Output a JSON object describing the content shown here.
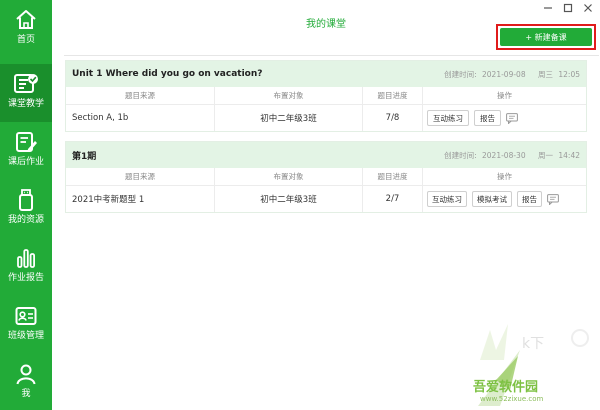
{
  "sidebar": {
    "items": [
      {
        "label": "首页",
        "icon": "home-icon"
      },
      {
        "label": "课堂教学",
        "icon": "classroom-icon",
        "active": true
      },
      {
        "label": "课后作业",
        "icon": "homework-icon"
      },
      {
        "label": "我的资源",
        "icon": "resource-icon"
      },
      {
        "label": "作业报告",
        "icon": "report-chart-icon"
      },
      {
        "label": "班级管理",
        "icon": "class-manage-icon"
      },
      {
        "label": "我",
        "icon": "user-icon"
      }
    ]
  },
  "header": {
    "title": "我的课堂",
    "new_button": "+ 新建备课"
  },
  "table_headers": [
    "题目来源",
    "布置对象",
    "题目进度",
    "操作"
  ],
  "lessons": [
    {
      "title": "Unit 1 Where did you go on vacation?",
      "created_label": "创建时间:",
      "created_date": "2021-09-08",
      "weekday": "周三",
      "time": "12:05",
      "rows": [
        {
          "source": "Section A, 1b",
          "target": "初中二年级3班",
          "progress": "7/8",
          "actions": [
            "互动练习",
            "报告"
          ]
        }
      ]
    },
    {
      "title": "第1期",
      "created_label": "创建时间:",
      "created_date": "2021-08-30",
      "weekday": "周一",
      "time": "14:42",
      "rows": [
        {
          "source": "2021中考新题型 1",
          "target": "初中二年级3班",
          "progress": "2/7",
          "actions": [
            "互动练习",
            "模拟考试",
            "报告"
          ]
        }
      ]
    }
  ],
  "watermark": {
    "site_name": "吾爱软件园",
    "url": "www.52zixue.com"
  },
  "colors": {
    "brand_green": "#22ab38",
    "active_nav": "#1a8f2c",
    "header_bg": "#e3f4e5",
    "highlight_red": "#e01b1b"
  }
}
